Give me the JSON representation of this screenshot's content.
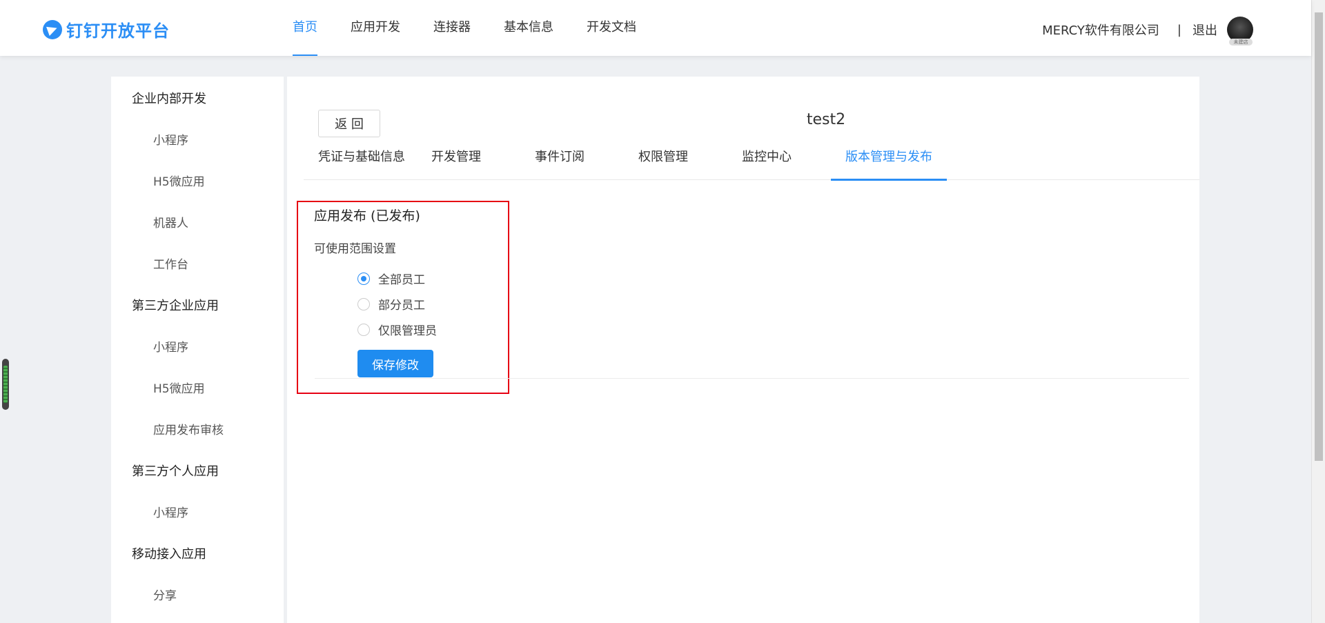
{
  "brand": {
    "name": "钉钉开放平台",
    "color": "#2b8ef5"
  },
  "nav": {
    "items": [
      "首页",
      "应用开发",
      "连接器",
      "基本信息",
      "开发文档"
    ],
    "active_index": 0
  },
  "header": {
    "company": "MERCY软件有限公司",
    "separator": "|",
    "logout": "退出",
    "avatar_badge": "未建店"
  },
  "sidebar": {
    "sections": [
      {
        "title": "企业内部开发",
        "items": [
          "小程序",
          "H5微应用",
          "机器人",
          "工作台"
        ]
      },
      {
        "title": "第三方企业应用",
        "items": [
          "小程序",
          "H5微应用",
          "应用发布审核"
        ]
      },
      {
        "title": "第三方个人应用",
        "items": [
          "小程序"
        ]
      },
      {
        "title": "移动接入应用",
        "items": [
          "分享"
        ]
      }
    ]
  },
  "main": {
    "back_label": "返 回",
    "app_title": "test2",
    "tabs": [
      "凭证与基础信息",
      "开发管理",
      "事件订阅",
      "权限管理",
      "监控中心",
      "版本管理与发布"
    ],
    "active_tab": 5,
    "publish": {
      "title": "应用发布 (已发布)",
      "scope_label": "可使用范围设置",
      "options": [
        {
          "label": "全部员工",
          "checked": true
        },
        {
          "label": "部分员工",
          "checked": false
        },
        {
          "label": "仅限管理员",
          "checked": false
        }
      ],
      "save_label": "保存修改"
    }
  },
  "colors": {
    "accent": "#2b8ef5",
    "highlight_border": "#e60012"
  }
}
